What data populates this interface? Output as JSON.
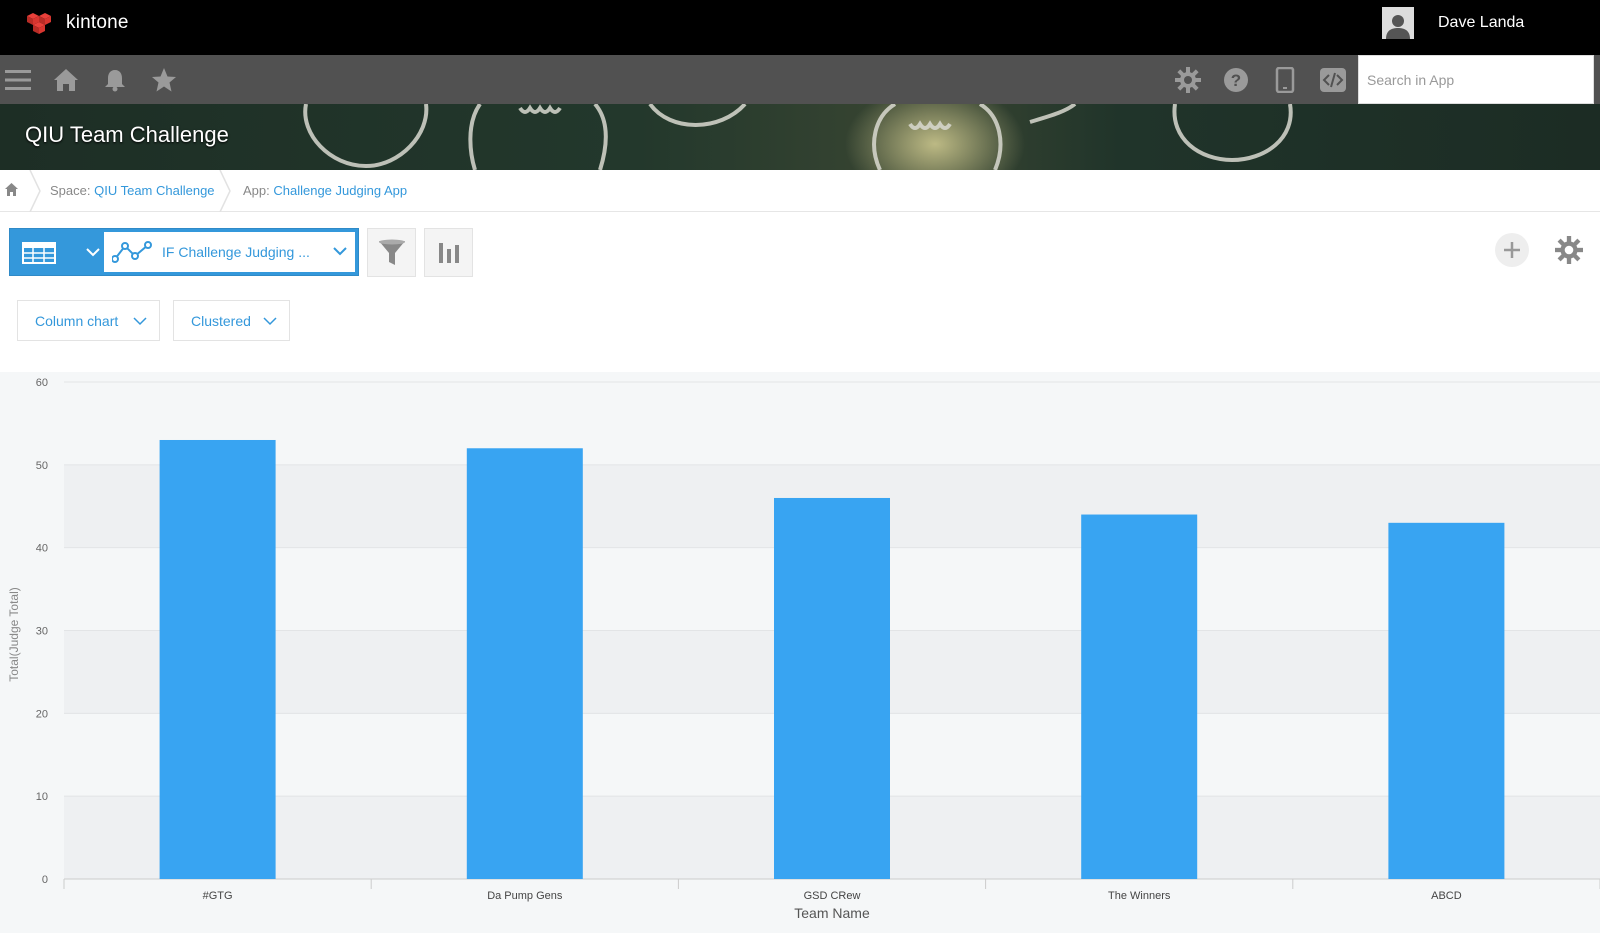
{
  "app": {
    "brand": "kintone"
  },
  "user": {
    "name": "Dave Landa"
  },
  "nav": {
    "left_icons": [
      "menu-icon",
      "home-icon",
      "bell-icon",
      "star-icon"
    ],
    "right_icons": [
      "gear-icon",
      "help-icon",
      "mobile-icon",
      "code-icon"
    ],
    "search_placeholder": "Search in App"
  },
  "banner": {
    "title": "QIU Team Challenge"
  },
  "breadcrumb": {
    "space_prefix": "Space: ",
    "space_link": "QIU Team Challenge",
    "app_prefix": "App: ",
    "app_link": "Challenge Judging App"
  },
  "toolbar": {
    "view_label": "IF Challenge Judging ...",
    "chart_type": "Column chart",
    "chart_mode": "Clustered"
  },
  "colors": {
    "accent": "#3498db",
    "bar": "#38a4f2"
  },
  "chart_data": {
    "type": "bar",
    "categories": [
      "#GTG",
      "Da Pump Gens",
      "GSD CRew",
      "The Winners",
      "ABCD"
    ],
    "values": [
      53,
      52,
      46,
      44,
      43
    ],
    "xlabel": "Team Name",
    "ylabel": "Total(Judge Total)",
    "ylim": [
      0,
      60
    ],
    "yticks": [
      0,
      10,
      20,
      30,
      40,
      50,
      60
    ],
    "grid": true
  }
}
